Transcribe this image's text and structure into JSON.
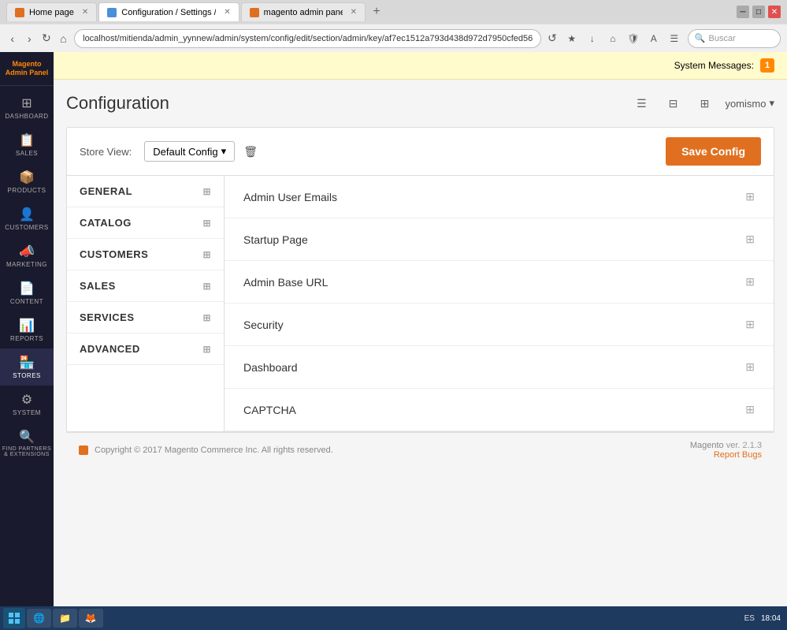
{
  "browser": {
    "tabs": [
      {
        "id": "tab1",
        "label": "Home page",
        "active": false,
        "favicon": "orange"
      },
      {
        "id": "tab2",
        "label": "Configuration / Settings /...",
        "active": true,
        "favicon": "blue"
      },
      {
        "id": "tab3",
        "label": "magento admin panel - M...",
        "active": false,
        "favicon": "orange"
      }
    ],
    "address": "localhost/mitienda/admin_yynnew/admin/system/config/edit/section/admin/key/af7ec1512a793d438d972d7950cfed56",
    "search_placeholder": "Buscar"
  },
  "system_messages": {
    "label": "System Messages:",
    "count": "1"
  },
  "sidebar": {
    "logo_line1": "Magento",
    "logo_line2": "Admin Panel",
    "items": [
      {
        "id": "dashboard",
        "label": "DASHBOARD",
        "icon": "⊞"
      },
      {
        "id": "sales",
        "label": "SALES",
        "icon": "📋"
      },
      {
        "id": "products",
        "label": "PRODUCTS",
        "icon": "📦"
      },
      {
        "id": "customers",
        "label": "CUSTOMERS",
        "icon": "👤"
      },
      {
        "id": "marketing",
        "label": "MARKETING",
        "icon": "📣"
      },
      {
        "id": "content",
        "label": "CONTENT",
        "icon": "📄"
      },
      {
        "id": "reports",
        "label": "REPORTS",
        "icon": "📊"
      },
      {
        "id": "stores",
        "label": "STORES",
        "icon": "🏪"
      },
      {
        "id": "system",
        "label": "SYSTEM",
        "icon": "⚙"
      },
      {
        "id": "find-partners",
        "label": "FIND PARTNERS & EXTENSIONS",
        "icon": "🔍"
      }
    ]
  },
  "page": {
    "title": "Configuration",
    "user_name": "yomismo"
  },
  "config": {
    "store_view_label": "Store View:",
    "store_view_value": "Default Config",
    "save_button_label": "Save Config",
    "left_nav": [
      {
        "id": "general",
        "label": "GENERAL"
      },
      {
        "id": "catalog",
        "label": "CATALOG"
      },
      {
        "id": "customers",
        "label": "CUSTOMERS"
      },
      {
        "id": "sales",
        "label": "SALES"
      },
      {
        "id": "services",
        "label": "SERVICES"
      },
      {
        "id": "advanced",
        "label": "ADVANCED"
      }
    ],
    "sections": [
      {
        "id": "admin-user-emails",
        "title": "Admin User Emails"
      },
      {
        "id": "startup-page",
        "title": "Startup Page"
      },
      {
        "id": "admin-base-url",
        "title": "Admin Base URL"
      },
      {
        "id": "security",
        "title": "Security"
      },
      {
        "id": "dashboard",
        "title": "Dashboard"
      },
      {
        "id": "captcha",
        "title": "CAPTCHA"
      }
    ]
  },
  "footer": {
    "copyright": "Copyright © 2017 Magento Commerce Inc. All rights reserved.",
    "magento_label": "Magento",
    "version": "ver. 2.1.3",
    "report_bugs": "Report Bugs"
  },
  "taskbar": {
    "language": "ES",
    "time": "18:04"
  }
}
